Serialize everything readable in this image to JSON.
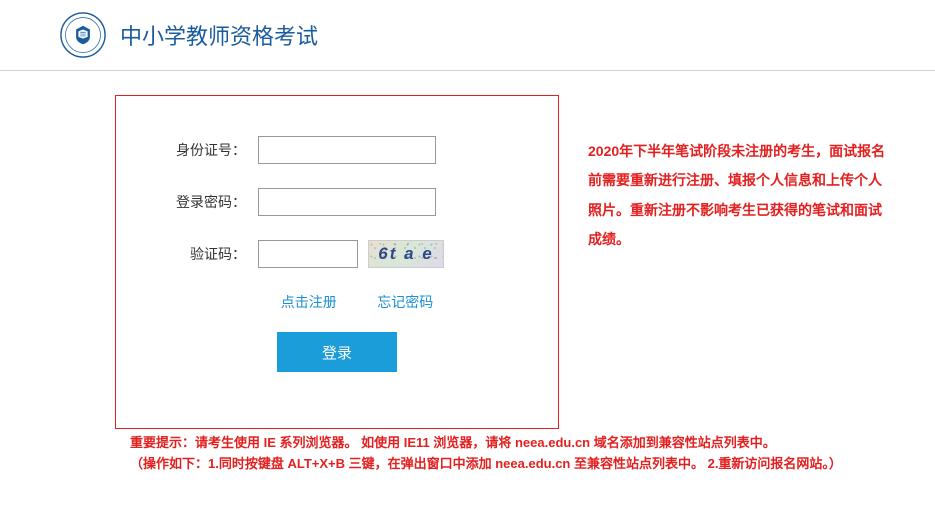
{
  "header": {
    "title": "中小学教师资格考试"
  },
  "form": {
    "id_label": "身份证号：",
    "id_value": "",
    "password_label": "登录密码：",
    "password_value": "",
    "captcha_label": "验证码：",
    "captcha_value": "",
    "captcha_text": "6t a e",
    "register_link": "点击注册",
    "forgot_link": "忘记密码",
    "login_button": "登录"
  },
  "side_notice": "2020年下半年笔试阶段未注册的考生，面试报名前需要重新进行注册、填报个人信息和上传个人照片。重新注册不影响考生已获得的笔试和面试成绩。",
  "bottom_notice_line1": "重要提示：请考生使用 IE 系列浏览器。 如使用 IE11 浏览器，请将 neea.edu.cn 域名添加到兼容性站点列表中。",
  "bottom_notice_line2": "（操作如下：1.同时按键盘 ALT+X+B 三键，在弹出窗口中添加 neea.edu.cn 至兼容性站点列表中。 2.重新访问报名网站。）"
}
